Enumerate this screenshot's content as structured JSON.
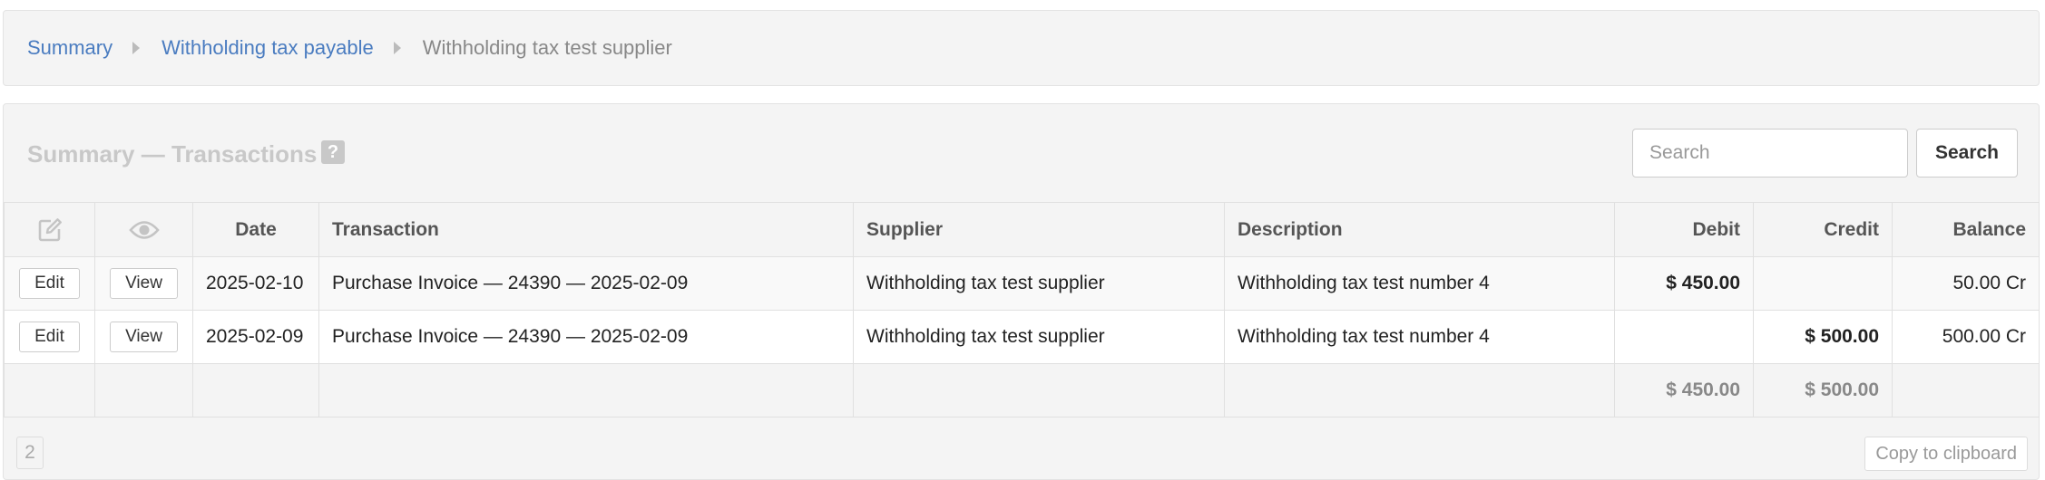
{
  "breadcrumb": {
    "items": [
      {
        "label": "Summary"
      },
      {
        "label": "Withholding tax payable"
      },
      {
        "label": "Withholding tax test supplier"
      }
    ]
  },
  "panel": {
    "title": "Summary — Transactions",
    "help_glyph": "?"
  },
  "search": {
    "placeholder": "Search",
    "button_label": "Search"
  },
  "table": {
    "columns": {
      "edit": "edit-icon",
      "view": "eye-icon",
      "date": "Date",
      "transaction": "Transaction",
      "supplier": "Supplier",
      "description": "Description",
      "debit": "Debit",
      "credit": "Credit",
      "balance": "Balance"
    },
    "rows": [
      {
        "edit_label": "Edit",
        "view_label": "View",
        "date": "2025-02-10",
        "transaction": "Purchase Invoice — 24390 — 2025-02-09",
        "supplier": "Withholding tax test supplier",
        "description": "Withholding tax test number 4",
        "debit": "$ 450.00",
        "credit": "",
        "balance": "50.00 Cr"
      },
      {
        "edit_label": "Edit",
        "view_label": "View",
        "date": "2025-02-09",
        "transaction": "Purchase Invoice — 24390 — 2025-02-09",
        "supplier": "Withholding tax test supplier",
        "description": "Withholding tax test number 4",
        "debit": "",
        "credit": "$ 500.00",
        "balance": "500.00 Cr"
      }
    ],
    "totals": {
      "debit": "$ 450.00",
      "credit": "$ 500.00"
    }
  },
  "footer": {
    "page_count": "2",
    "copy_label": "Copy to clipboard"
  },
  "colors": {
    "link": "#4a7cc0",
    "panel_bg": "#f4f4f4",
    "muted_title": "#c8c8c8"
  }
}
